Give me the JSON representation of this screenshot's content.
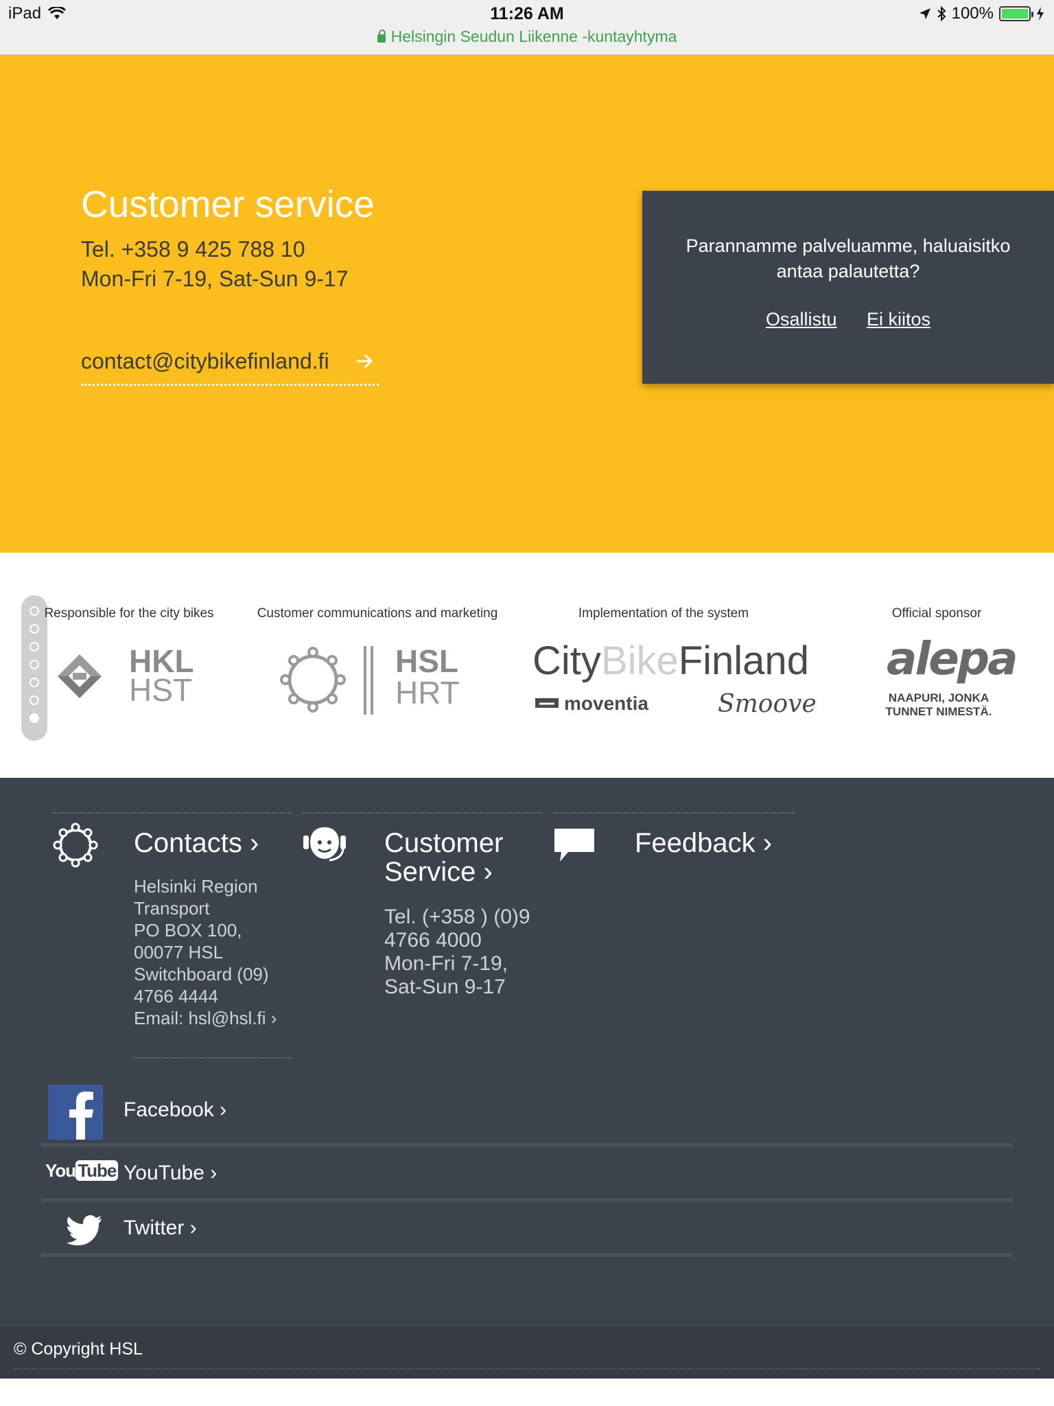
{
  "status_bar": {
    "device": "iPad",
    "time": "11:26 AM",
    "battery": "100%",
    "url_title": "Helsingin Seudun Liikenne -kuntayhtyma"
  },
  "hero": {
    "title": "Customer service",
    "tel": "Tel. +358 9 425 788 10",
    "hours": "Mon-Fri 7-19, Sat-Sun 9-17",
    "email": "contact@citybikefinland.fi"
  },
  "popup": {
    "question": "Parannamme palveluamme, haluaisitko antaa palautetta?",
    "participate": "Osallistu",
    "decline": "Ei kiitos"
  },
  "sponsors": [
    {
      "label": "Responsible for the city bikes",
      "logo_top": "HKL",
      "logo_bottom": "HST"
    },
    {
      "label": "Customer communications and marketing",
      "logo_top": "HSL",
      "logo_bottom": "HRT"
    },
    {
      "label": "Implementation of the system",
      "logo_city": "City",
      "logo_bike": "Bike",
      "logo_finland": "Finland",
      "logo_moventia": "moventia",
      "logo_smoove": "Smoove"
    },
    {
      "label": "Official sponsor",
      "logo_name": "alepa",
      "slogan_1": "NAAPURI, JONKA",
      "slogan_2": "TUNNET NIMESTÄ."
    }
  ],
  "footer": {
    "contacts": {
      "title": "Contacts ›",
      "lines": [
        "Helsinki Region",
        "Transport",
        "PO BOX 100,",
        "00077 HSL",
        "Switchboard (09)",
        "4766 4444",
        "Email: hsl@hsl.fi ›"
      ]
    },
    "customer_service": {
      "title_1": "Customer",
      "title_2": "Service ›",
      "lines": [
        "Tel. (+358 ) (0)9",
        "4766 4000",
        "Mon-Fri 7-19,",
        "Sat-Sun 9-17"
      ]
    },
    "feedback": {
      "title": "Feedback ›"
    },
    "social": [
      {
        "label": "Facebook ›",
        "icon": "facebook-icon"
      },
      {
        "label": "YouTube ›",
        "icon": "youtube-icon"
      },
      {
        "label": "Twitter ›",
        "icon": "twitter-icon"
      }
    ],
    "copyright": "© Copyright HSL"
  },
  "colors": {
    "hero_yellow": "#fbbe1e",
    "footer_dark": "#3d434c",
    "url_green": "#3fa24f"
  }
}
